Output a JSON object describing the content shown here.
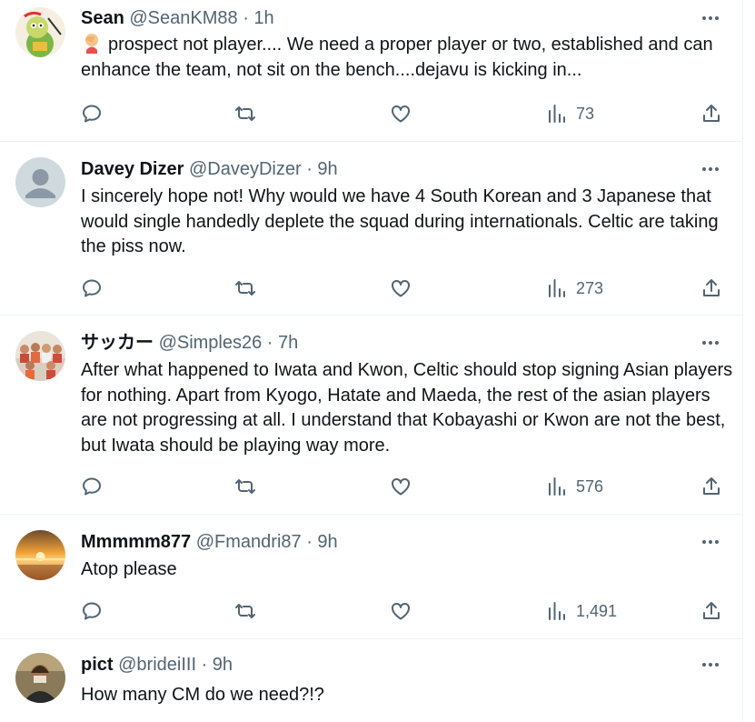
{
  "tweets": [
    {
      "display_name": "Sean",
      "handle": "@SeanKM88",
      "separator": " · ",
      "time": "1h",
      "text": "prospect not player.... We need a proper player or two, established and can enhance the team, not sit on the bench....dejavu is kicking in...",
      "views": "73",
      "avatar_icon": "cartoon-character-avatar",
      "leading_emoji": "person-facepalming-emoji"
    },
    {
      "display_name": "Davey Dizer",
      "handle": "@DaveyDizer",
      "separator": " · ",
      "time": "9h",
      "text": "I sincerely hope not! Why would we have 4 South Korean and 3 Japanese that would single handedly deplete the squad during internationals. Celtic are taking the piss now.",
      "views": "273",
      "avatar_icon": "default-profile-avatar"
    },
    {
      "display_name": "サッカー",
      "handle": "@Simples26",
      "separator": " · ",
      "time": "7h",
      "text": "After what happened to Iwata and Kwon, Celtic should stop signing Asian players for nothing. Apart from Kyogo, Hatate and Maeda, the rest of the asian players are not progressing at all. I understand that Kobayashi  or Kwon are not the best, but Iwata should be playing way more.",
      "views": "576",
      "avatar_icon": "group-photo-avatar"
    },
    {
      "display_name": "Mmmmm877",
      "handle": "@Fmandri87",
      "separator": " · ",
      "time": "9h",
      "text": "Atop please",
      "views": "1,491",
      "avatar_icon": "sunset-photo-avatar"
    },
    {
      "display_name": "pict",
      "handle": "@brideiIII",
      "separator": " · ",
      "time": "9h",
      "text": "How many CM do we need?!?",
      "avatar_icon": "person-photo-avatar"
    }
  ],
  "colors": {
    "text_primary": "#0f1419",
    "text_secondary": "#536471",
    "border": "#eff3f4"
  }
}
